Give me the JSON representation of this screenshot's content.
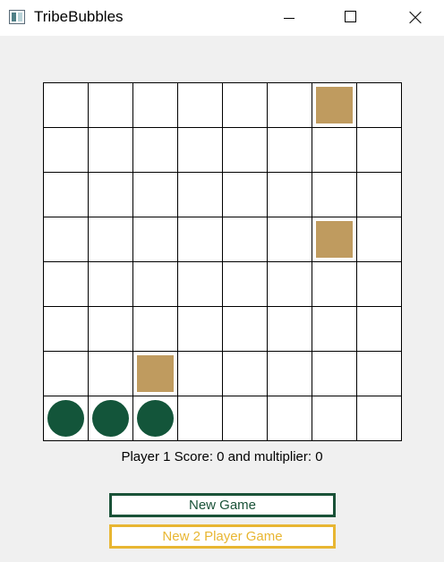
{
  "window": {
    "title": "TribeBubbles"
  },
  "colors": {
    "block": "#bf9b5f",
    "bubble": "#13553a",
    "new_game_accent": "#1a5238",
    "new_2p_accent": "#e8b632"
  },
  "board": {
    "rows": 8,
    "cols": 8,
    "blocks": [
      [
        0,
        6
      ],
      [
        3,
        6
      ],
      [
        6,
        2
      ]
    ],
    "bubbles": [
      [
        7,
        0
      ],
      [
        7,
        1
      ],
      [
        7,
        2
      ]
    ]
  },
  "status": {
    "score_text": "Player 1 Score: 0 and multiplier: 0"
  },
  "buttons": {
    "new_game_label": "New Game",
    "new_2p_label": "New 2 Player Game"
  }
}
